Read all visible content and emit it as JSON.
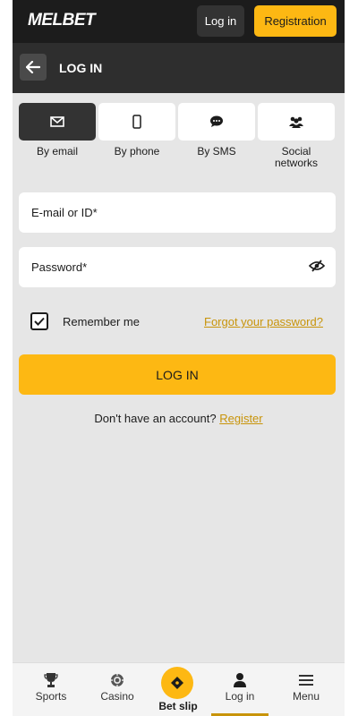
{
  "brand": {
    "logo_part1": "MEL",
    "logo_part2": "BET"
  },
  "header": {
    "login_label": "Log in",
    "registration_label": "Registration"
  },
  "subheader": {
    "title": "LOG IN"
  },
  "methods": [
    {
      "label": "By email",
      "icon": "envelope-icon",
      "active": true
    },
    {
      "label": "By phone",
      "icon": "phone-icon",
      "active": false
    },
    {
      "label": "By SMS",
      "icon": "chat-icon",
      "active": false
    },
    {
      "label": "Social networks",
      "icon": "users-icon",
      "active": false
    }
  ],
  "form": {
    "email_placeholder": "E-mail or ID*",
    "password_placeholder": "Password*",
    "remember_label": "Remember me",
    "remember_checked": true,
    "forgot_label": "Forgot your password?",
    "login_button": "LOG IN",
    "no_account_text": "Don't have an account?",
    "register_link": "Register"
  },
  "bottom_nav": {
    "sports": "Sports",
    "casino": "Casino",
    "betslip": "Bet slip",
    "login": "Log in",
    "menu": "Menu"
  },
  "colors": {
    "accent": "#fdb813",
    "dark": "#1c1c1c",
    "link": "#c8940a"
  }
}
